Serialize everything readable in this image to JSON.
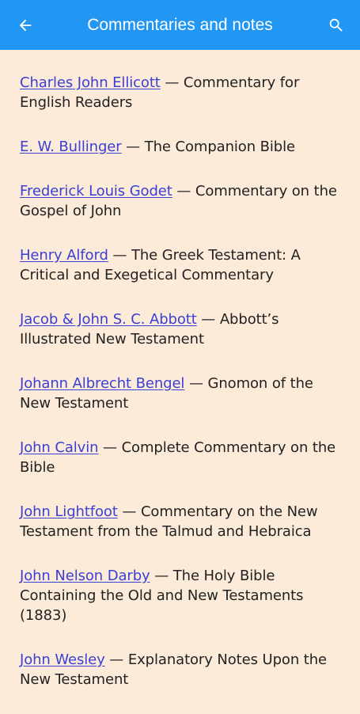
{
  "header": {
    "title": "Commentaries and notes",
    "back_icon": "arrow-left-icon",
    "search_icon": "search-icon",
    "background": "#2196f3"
  },
  "colors": {
    "background": "#fcebd8",
    "link": "#3a3fd6",
    "text": "#222222"
  },
  "entries": [
    {
      "author": "Charles John Ellicott",
      "work": "Commentary for English Readers"
    },
    {
      "author": "E. W. Bullinger",
      "work": "The Companion Bible"
    },
    {
      "author": "Frederick Louis Godet",
      "work": "Commentary on the Gospel of John"
    },
    {
      "author": "Henry Alford",
      "work": "The Greek Testament: A Critical and Exegetical Commentary"
    },
    {
      "author": "Jacob & John S. C. Abbott",
      "work": "Abbott’s Illustrated New Testament"
    },
    {
      "author": "Johann Albrecht Bengel",
      "work": "Gnomon of the New Testament"
    },
    {
      "author": "John Calvin",
      "work": "Complete Commentary on the Bible"
    },
    {
      "author": "John Lightfoot",
      "work": "Commentary on the New Testament from the Talmud and Hebraica"
    },
    {
      "author": "John Nelson Darby",
      "work": "The Holy Bible Containing the Old and New Testaments (1883)"
    },
    {
      "author": "John Wesley",
      "work": "Explanatory Notes Upon the New Testament"
    }
  ],
  "separator": " — "
}
